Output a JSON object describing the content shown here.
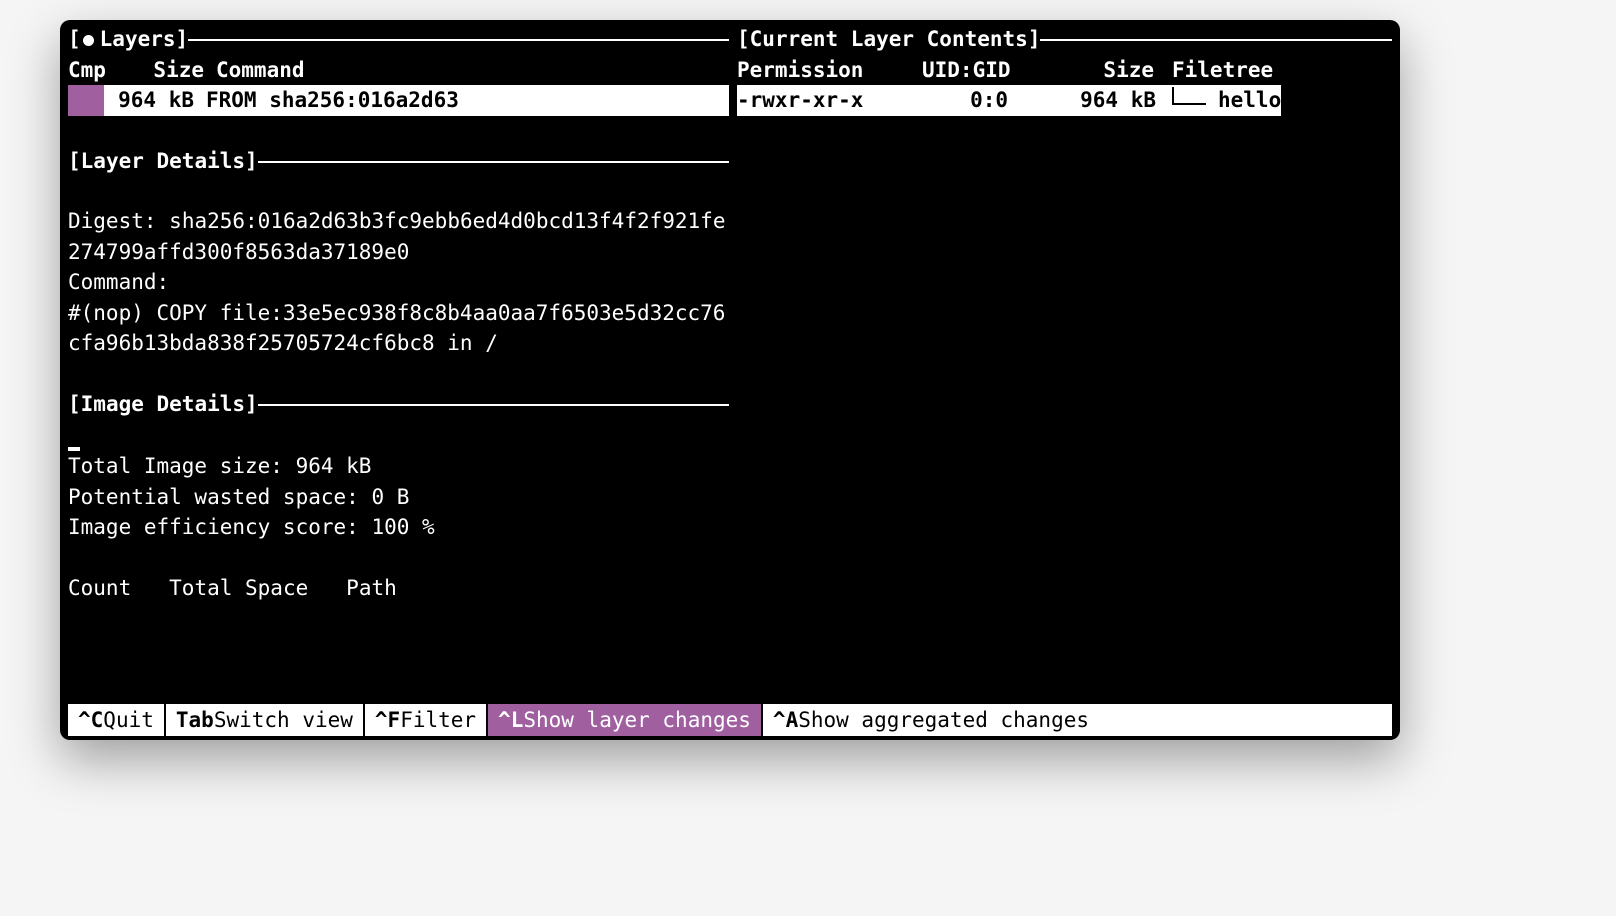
{
  "panels": {
    "layers_title": "Layers",
    "layer_details_title": "Layer Details",
    "image_details_title": "Image Details",
    "contents_title": "Current Layer Contents"
  },
  "layers": {
    "columns": {
      "cmp": "Cmp",
      "size": "Size",
      "command": "Command"
    },
    "rows": [
      {
        "cmp": "",
        "size": "964 kB",
        "command": "FROM sha256:016a2d63"
      }
    ]
  },
  "layer_details": {
    "digest_label": "Digest:",
    "digest_value": "sha256:016a2d63b3fc9ebb6ed4d0bcd13f4f2f921fe274799affd300f8563da37189e0",
    "command_label": "Command:",
    "command_value": "#(nop) COPY file:33e5ec938f8c8b4aa0aa7f6503e5d32cc76cfa96b13bda838f25705724cf6bc8 in /"
  },
  "image_details": {
    "total_size_label": "Total Image size:",
    "total_size_value": "964 kB",
    "wasted_label": "Potential wasted space:",
    "wasted_value": "0 B",
    "efficiency_label": "Image efficiency score:",
    "efficiency_value": "100 %",
    "table_head": {
      "count": "Count",
      "total_space": "Total Space",
      "path": "Path"
    }
  },
  "filetree": {
    "columns": {
      "perm": "Permission",
      "uid": "UID:GID",
      "size": "Size",
      "tree": "Filetree"
    },
    "rows": [
      {
        "perm": "-rwxr-xr-x",
        "uid": "0:0",
        "size": "964 kB",
        "name": "hello"
      }
    ]
  },
  "footer": [
    {
      "key": "^C",
      "label": "Quit",
      "active": false
    },
    {
      "key": "Tab",
      "label": "Switch view",
      "active": false
    },
    {
      "key": "^F",
      "label": "Filter",
      "active": false
    },
    {
      "key": "^L",
      "label": "Show layer changes",
      "active": true
    },
    {
      "key": "^A",
      "label": "Show aggregated changes",
      "active": false
    }
  ]
}
